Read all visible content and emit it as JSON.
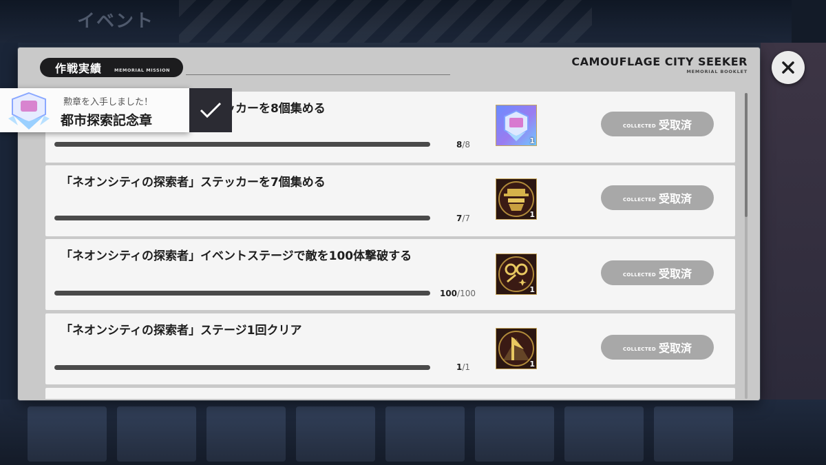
{
  "background": {
    "title": "イベント"
  },
  "modal": {
    "tab_title": "作戦実績",
    "tab_subtitle": "MEMORIAL MISSION",
    "brand_title": "CAMOUFLAGE CITY SEEKER",
    "brand_subtitle": "MEMORIAL BOOKLET"
  },
  "missions": [
    {
      "title": "「ネオンシティの探索者」ステッカーを8個集める",
      "progress": "8",
      "total": "/8",
      "progress_fraction": 1.0,
      "reward_icon": "medal-icon",
      "reward_qty": "1",
      "collected_small": "COLLECTED",
      "collected_label": "受取済"
    },
    {
      "title": "「ネオンシティの探索者」ステッカーを7個集める",
      "progress": "7",
      "total": "/7",
      "progress_fraction": 1.0,
      "reward_icon": "detective-icon",
      "reward_qty": "1",
      "collected_small": "COLLECTED",
      "collected_label": "受取済"
    },
    {
      "title": "「ネオンシティの探索者」イベントステージで敵を100体撃破する",
      "progress": "100",
      "total": "/100",
      "progress_fraction": 1.0,
      "reward_icon": "handcuffs-icon",
      "reward_qty": "1",
      "collected_small": "COLLECTED",
      "collected_label": "受取済"
    },
    {
      "title": "「ネオンシティの探索者」ステージ1回クリア",
      "progress": "1",
      "total": "/1",
      "progress_fraction": 1.0,
      "reward_icon": "flag-icon",
      "reward_qty": "1",
      "collected_small": "COLLECTED",
      "collected_label": "受取済"
    }
  ],
  "toast": {
    "line1": "勲章を入手しました！",
    "line2": "都市探索記念章"
  },
  "colors": {
    "accent_dark": "#1c1c1e",
    "collected_gray": "#a8a8a8",
    "progress_bar": "#4a4a4a"
  }
}
